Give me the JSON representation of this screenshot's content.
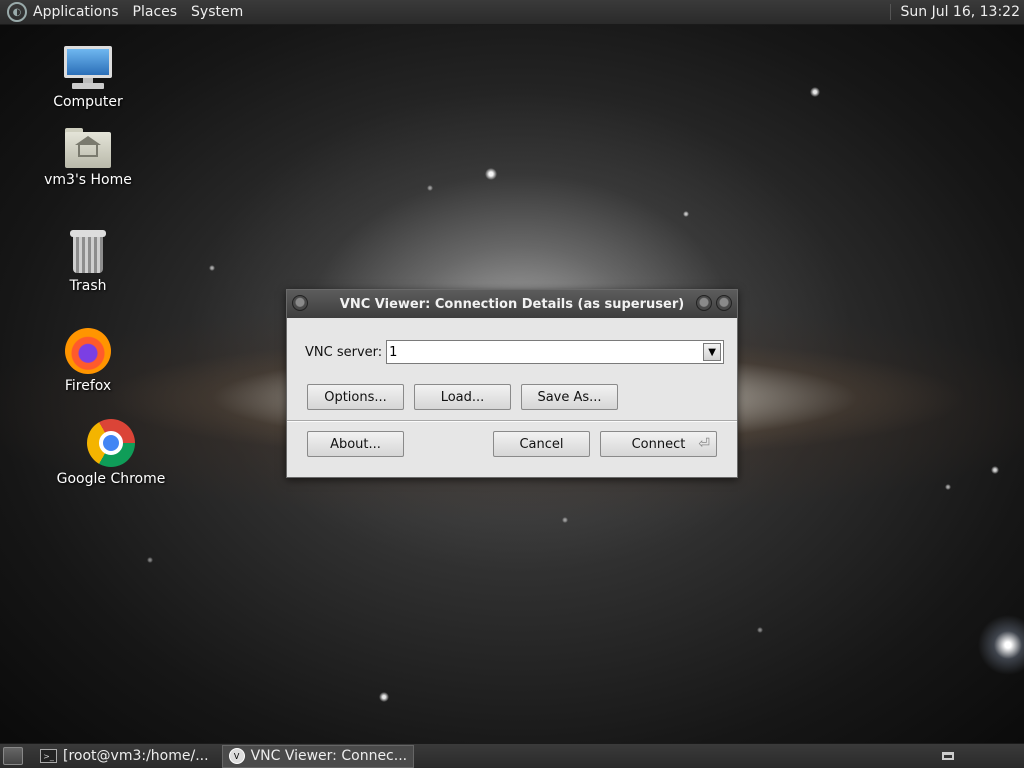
{
  "top_panel": {
    "menus": [
      "Applications",
      "Places",
      "System"
    ],
    "clock": "Sun Jul 16, 13:22"
  },
  "desktop_icons": [
    {
      "label": "Computer"
    },
    {
      "label": "vm3's Home"
    },
    {
      "label": "Trash"
    },
    {
      "label": "Firefox"
    },
    {
      "label": "Google Chrome"
    }
  ],
  "dialog": {
    "title": "VNC Viewer: Connection Details (as superuser)",
    "server_label": "VNC server:",
    "server_value": "1",
    "buttons": {
      "options": "Options...",
      "load": "Load...",
      "save_as": "Save As...",
      "about": "About...",
      "cancel": "Cancel",
      "connect": "Connect"
    }
  },
  "taskbar": {
    "tasks": [
      {
        "label": "[root@vm3:/home/..."
      },
      {
        "label": "VNC Viewer: Connec..."
      }
    ]
  }
}
